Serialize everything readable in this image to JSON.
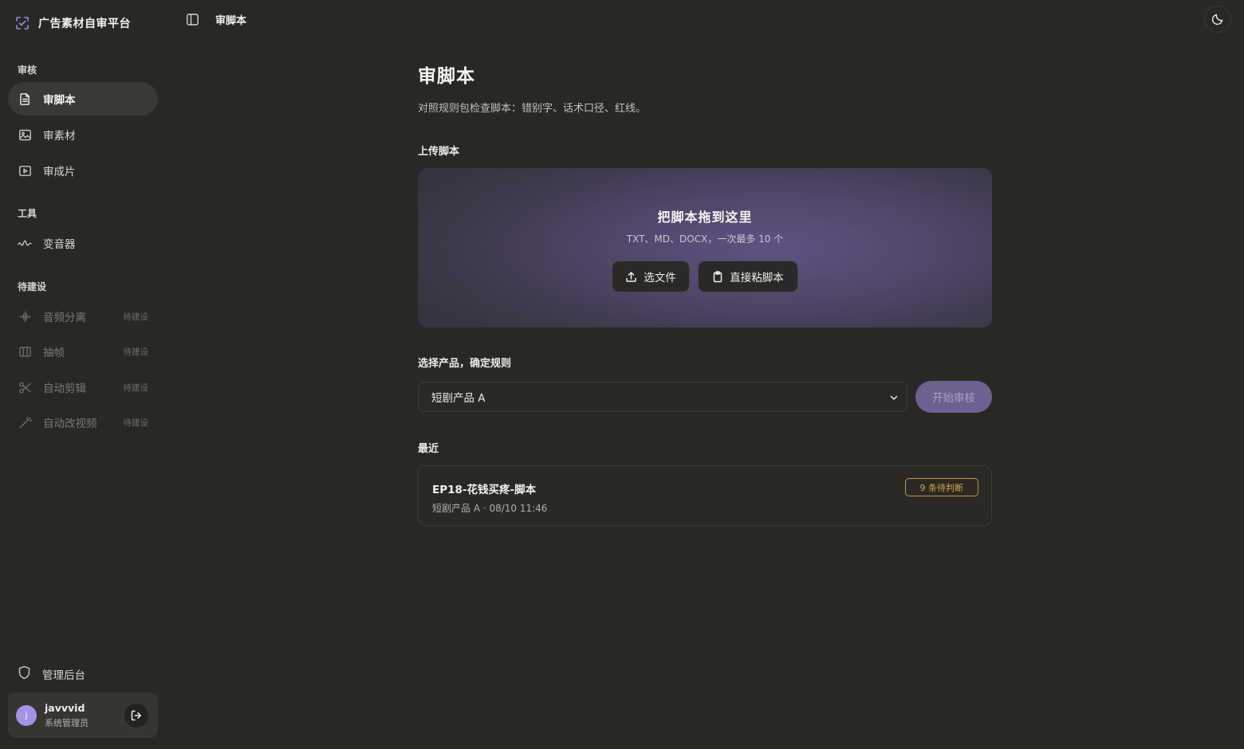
{
  "app": {
    "name": "广告素材自审平台"
  },
  "topbar": {
    "title": "审脚本"
  },
  "sidebar": {
    "sections": {
      "review": "审核",
      "tools": "工具",
      "pending": "待建设"
    },
    "review_items": [
      {
        "label": "审脚本",
        "icon": "document-icon",
        "active": true
      },
      {
        "label": "审素材",
        "icon": "image-icon"
      },
      {
        "label": "审成片",
        "icon": "video-icon"
      }
    ],
    "tool_items": [
      {
        "label": "变音器",
        "icon": "waveform-icon"
      }
    ],
    "pending_items": [
      {
        "label": "音频分离",
        "icon": "audio-split-icon",
        "tag": "待建设"
      },
      {
        "label": "抽帧",
        "icon": "frames-icon",
        "tag": "待建设"
      },
      {
        "label": "自动剪辑",
        "icon": "scissors-icon",
        "tag": "待建设"
      },
      {
        "label": "自动改视频",
        "icon": "magic-wand-icon",
        "tag": "待建设"
      }
    ],
    "admin": {
      "label": "管理后台",
      "icon": "shield-icon"
    },
    "user": {
      "avatar_letter": "j",
      "name": "javvvid",
      "role": "系统管理员"
    }
  },
  "main": {
    "title": "审脚本",
    "description": "对照规则包检查脚本：错别字、话术口径、红线。",
    "upload": {
      "label": "上传脚本",
      "dropzone_title": "把脚本拖到这里",
      "dropzone_hint": "TXT、MD、DOCX，一次最多 10 个",
      "choose_file": "选文件",
      "paste_script": "直接粘脚本"
    },
    "product": {
      "label": "选择产品，确定规则",
      "selected": "短剧产品 A",
      "start_button": "开始审核"
    },
    "recent": {
      "label": "最近",
      "items": [
        {
          "title": "EP18-花钱买疼-脚本",
          "subtitle": "短剧产品 A · 08/10 11:46",
          "badge": "9 条待判断"
        }
      ]
    }
  },
  "colors": {
    "background": "#292825",
    "accent": "#6c6190",
    "warning": "#d9a24a"
  }
}
